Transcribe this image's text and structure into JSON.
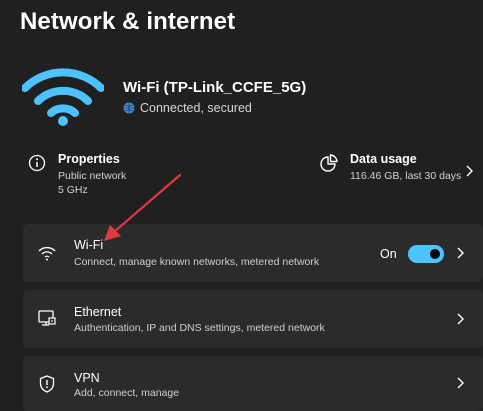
{
  "page": {
    "title": "Network & internet"
  },
  "connection": {
    "name": "Wi-Fi (TP-Link_CCFE_5G)",
    "status": "Connected, secured"
  },
  "properties": {
    "title": "Properties",
    "line1": "Public network",
    "line2": "5 GHz"
  },
  "data_usage": {
    "title": "Data usage",
    "value": "116.46 GB, last 30 days"
  },
  "settings": [
    {
      "title": "Wi-Fi",
      "desc": "Connect, manage known networks, metered network",
      "toggle_label": "On",
      "icon": "wifi-icon"
    },
    {
      "title": "Ethernet",
      "desc": "Authentication, IP and DNS settings, metered network",
      "icon": "ethernet-icon"
    },
    {
      "title": "VPN",
      "desc": "Add, connect, manage",
      "icon": "shield-icon"
    }
  ],
  "colors": {
    "background": "#202020",
    "card": "#2b2b2b",
    "accent": "#4cc2ff",
    "annotation_arrow": "#e0393e"
  }
}
